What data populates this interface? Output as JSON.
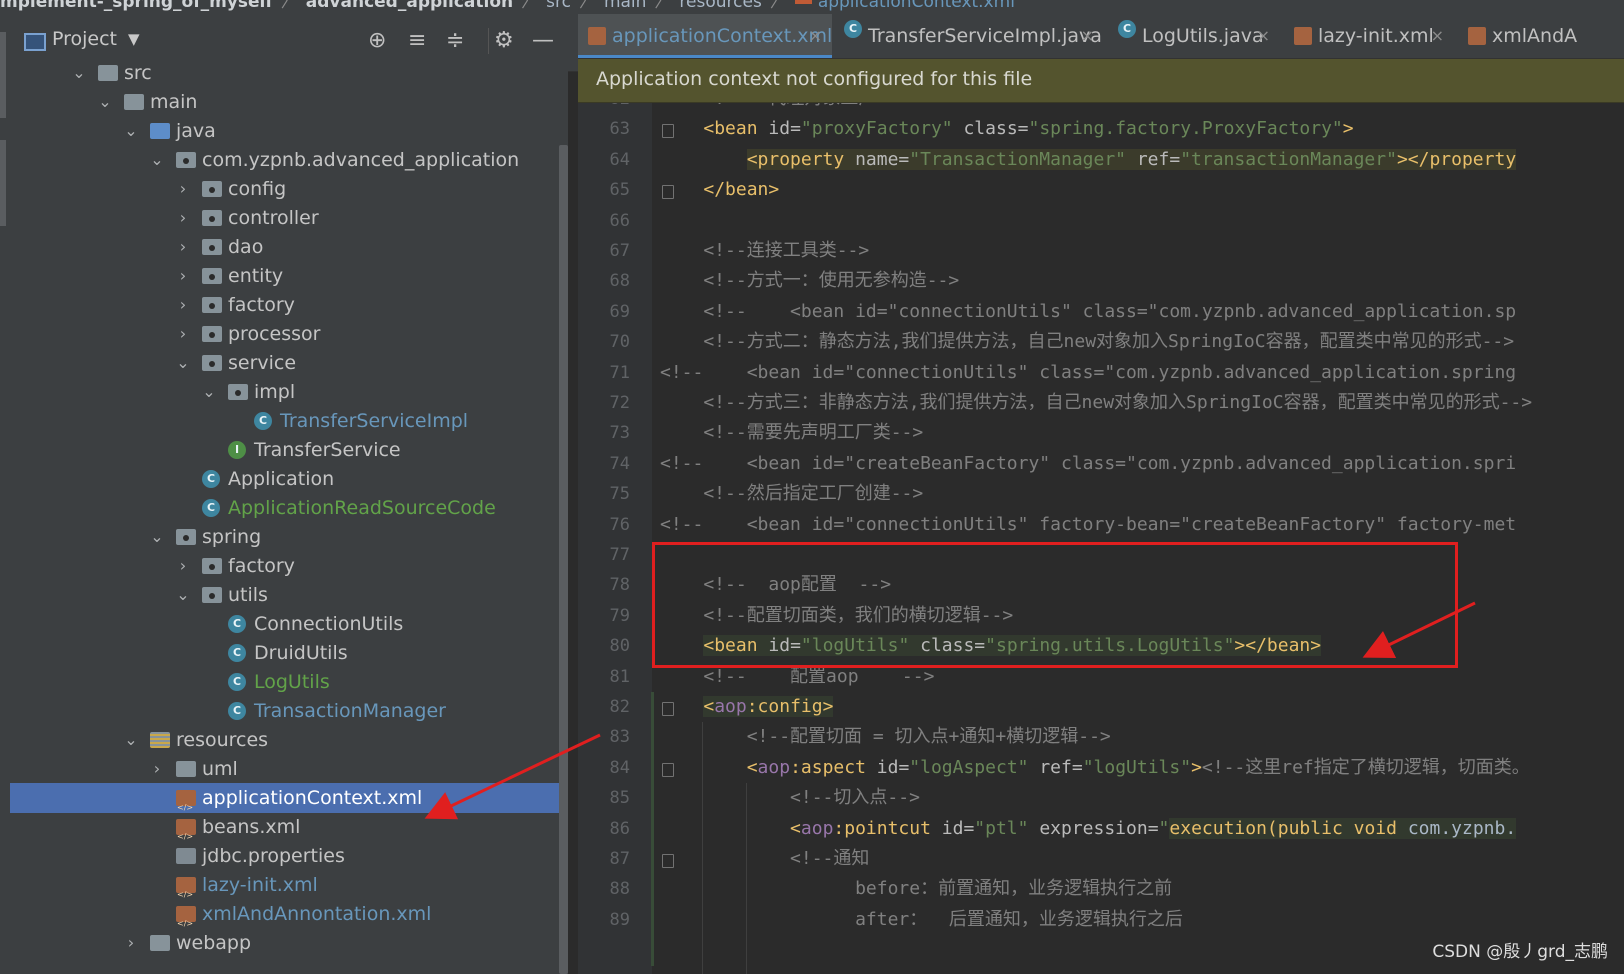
{
  "breadcrumb": {
    "items": [
      "mplement-_spring_of_myself",
      "advanced_application",
      "src",
      "main",
      "resources",
      "applicationContext.xml"
    ],
    "separator": "〉"
  },
  "project_panel": {
    "title": "Project",
    "toolbar_icons": [
      "locate-icon",
      "expand-all-icon",
      "collapse-all-icon",
      "gear-icon",
      "minimize-icon"
    ]
  },
  "tree": [
    {
      "label": "src",
      "depth": 3,
      "type": "folder",
      "open": true
    },
    {
      "label": "main",
      "depth": 4,
      "type": "folder",
      "open": true
    },
    {
      "label": "java",
      "depth": 5,
      "type": "folder-blue",
      "open": true
    },
    {
      "label": "com.yzpnb.advanced_application",
      "depth": 6,
      "type": "package",
      "open": true
    },
    {
      "label": "config",
      "depth": 7,
      "type": "package",
      "open": false
    },
    {
      "label": "controller",
      "depth": 7,
      "type": "package",
      "open": false
    },
    {
      "label": "dao",
      "depth": 7,
      "type": "package",
      "open": false
    },
    {
      "label": "entity",
      "depth": 7,
      "type": "package",
      "open": false
    },
    {
      "label": "factory",
      "depth": 7,
      "type": "package",
      "open": false
    },
    {
      "label": "processor",
      "depth": 7,
      "type": "package",
      "open": false
    },
    {
      "label": "service",
      "depth": 7,
      "type": "package",
      "open": true
    },
    {
      "label": "impl",
      "depth": 8,
      "type": "package",
      "open": true
    },
    {
      "label": "TransferServiceImpl",
      "depth": 9,
      "type": "class",
      "color": "blue"
    },
    {
      "label": "TransferService",
      "depth": 8,
      "type": "interface"
    },
    {
      "label": "Application",
      "depth": 7,
      "type": "class"
    },
    {
      "label": "ApplicationReadSourceCode",
      "depth": 7,
      "type": "class",
      "color": "green"
    },
    {
      "label": "spring",
      "depth": 6,
      "type": "package",
      "open": true
    },
    {
      "label": "factory",
      "depth": 7,
      "type": "package",
      "open": false
    },
    {
      "label": "utils",
      "depth": 7,
      "type": "package",
      "open": true
    },
    {
      "label": "ConnectionUtils",
      "depth": 8,
      "type": "class"
    },
    {
      "label": "DruidUtils",
      "depth": 8,
      "type": "class"
    },
    {
      "label": "LogUtils",
      "depth": 8,
      "type": "class",
      "color": "green"
    },
    {
      "label": "TransactionManager",
      "depth": 8,
      "type": "class",
      "color": "blue"
    },
    {
      "label": "resources",
      "depth": 5,
      "type": "resources",
      "open": true
    },
    {
      "label": "uml",
      "depth": 6,
      "type": "folder",
      "open": false
    },
    {
      "label": "applicationContext.xml",
      "depth": 6,
      "type": "xml",
      "selected": true
    },
    {
      "label": "beans.xml",
      "depth": 6,
      "type": "xml"
    },
    {
      "label": "jdbc.properties",
      "depth": 6,
      "type": "properties"
    },
    {
      "label": "lazy-init.xml",
      "depth": 6,
      "type": "xml",
      "color": "blue"
    },
    {
      "label": "xmlAndAnnontation.xml",
      "depth": 6,
      "type": "xml",
      "color": "blue"
    },
    {
      "label": "webapp",
      "depth": 5,
      "type": "folder",
      "open": false
    }
  ],
  "tabs": [
    {
      "label": "applicationContext.xml",
      "icon": "xml-file-icon",
      "active": true,
      "close": "×"
    },
    {
      "label": "TransferServiceImpl.java",
      "icon": "class-icon",
      "close": "×"
    },
    {
      "label": "LogUtils.java",
      "icon": "class-icon",
      "close": "×"
    },
    {
      "label": "lazy-init.xml",
      "icon": "xml-file-icon",
      "close": "×"
    },
    {
      "label": "xmlAndA",
      "icon": "xml-file-icon"
    }
  ],
  "banner": "Application context not configured for this file",
  "code": [
    {
      "n": "62",
      "parts": [
        [
          "cm",
          "    <!--  代理对象工厂  -->"
        ]
      ]
    },
    {
      "n": "63",
      "parts": [
        [
          "tx",
          "    "
        ],
        [
          "tg",
          "<bean "
        ],
        [
          "at",
          "id="
        ],
        [
          "av",
          "\"proxyFactory\" "
        ],
        [
          "at",
          "class="
        ],
        [
          "av",
          "\"spring.factory.ProxyFactory\""
        ],
        [
          "tg",
          ">"
        ]
      ]
    },
    {
      "n": "64",
      "parts": [
        [
          "tx",
          "        "
        ],
        [
          "tg hl",
          "<property "
        ],
        [
          "at hl",
          "name="
        ],
        [
          "av hl",
          "\"TransactionManager\" "
        ],
        [
          "at hl",
          "ref="
        ],
        [
          "av hl",
          "\"transactionManager\""
        ],
        [
          "tg hl",
          "></property"
        ]
      ]
    },
    {
      "n": "65",
      "parts": [
        [
          "tx",
          "    "
        ],
        [
          "tg",
          "</bean>"
        ]
      ]
    },
    {
      "n": "66",
      "parts": [
        [
          "tx",
          ""
        ]
      ]
    },
    {
      "n": "67",
      "parts": [
        [
          "cm",
          "    <!--连接工具类-->"
        ]
      ]
    },
    {
      "n": "68",
      "parts": [
        [
          "cm",
          "    <!--方式一：使用无参构造-->"
        ]
      ]
    },
    {
      "n": "69",
      "parts": [
        [
          "cm",
          "    <!--    <bean id=\"connectionUtils\" class=\"com.yzpnb.advanced_application.sp"
        ]
      ]
    },
    {
      "n": "70",
      "parts": [
        [
          "cm",
          "    <!--方式二：静态方法,我们提供方法，自己new对象加入SpringIoC容器，配置类中常见的形式-->"
        ]
      ]
    },
    {
      "n": "71",
      "parts": [
        [
          "cm",
          "<!--    <bean id=\"connectionUtils\" class=\"com.yzpnb.advanced_application.spring"
        ]
      ]
    },
    {
      "n": "72",
      "parts": [
        [
          "cm",
          "    <!--方式三：非静态方法,我们提供方法，自己new对象加入SpringIoC容器，配置类中常见的形式-->"
        ]
      ]
    },
    {
      "n": "73",
      "parts": [
        [
          "cm",
          "    <!--需要先声明工厂类-->"
        ]
      ]
    },
    {
      "n": "74",
      "parts": [
        [
          "cm",
          "<!--    <bean id=\"createBeanFactory\" class=\"com.yzpnb.advanced_application.spri"
        ]
      ]
    },
    {
      "n": "75",
      "parts": [
        [
          "cm",
          "    <!--然后指定工厂创建-->"
        ]
      ]
    },
    {
      "n": "76",
      "parts": [
        [
          "cm",
          "<!--    <bean id=\"connectionUtils\" factory-bean=\"createBeanFactory\" factory-met"
        ]
      ]
    },
    {
      "n": "77",
      "parts": [
        [
          "tx",
          ""
        ]
      ]
    },
    {
      "n": "78",
      "parts": [
        [
          "cm",
          "    <!--  aop配置  -->"
        ]
      ]
    },
    {
      "n": "79",
      "parts": [
        [
          "cm",
          "    <!--配置切面类，我们的横切逻辑-->"
        ]
      ]
    },
    {
      "n": "80",
      "parts": [
        [
          "tx",
          "    "
        ],
        [
          "tg hl2",
          "<bean "
        ],
        [
          "at hl2",
          "id="
        ],
        [
          "av hl2",
          "\"logUtils\" "
        ],
        [
          "at hl2",
          "class="
        ],
        [
          "av hl2",
          "\"spring.utils.LogUtils\""
        ],
        [
          "tg hl2",
          "></bean>"
        ]
      ]
    },
    {
      "n": "81",
      "parts": [
        [
          "cm",
          "    <!--    配置aop    -->"
        ]
      ]
    },
    {
      "n": "82",
      "parts": [
        [
          "tx",
          "    "
        ],
        [
          "tg hl2",
          "<"
        ],
        [
          "ns hl2",
          "aop"
        ],
        [
          "tg hl2",
          ":config>"
        ]
      ]
    },
    {
      "n": "83",
      "parts": [
        [
          "cm",
          "        <!--配置切面 = 切入点+通知+横切逻辑-->"
        ]
      ]
    },
    {
      "n": "84",
      "parts": [
        [
          "tx",
          "        "
        ],
        [
          "tg",
          "<"
        ],
        [
          "ns",
          "aop"
        ],
        [
          "tg",
          ":aspect "
        ],
        [
          "at",
          "id="
        ],
        [
          "av",
          "\"logAspect\" "
        ],
        [
          "at",
          "ref="
        ],
        [
          "av",
          "\"logUtils\""
        ],
        [
          "tg",
          ">"
        ],
        [
          "cm",
          "<!--这里ref指定了横切逻辑，切面类。"
        ]
      ]
    },
    {
      "n": "85",
      "parts": [
        [
          "cm",
          "            <!--切入点-->"
        ]
      ]
    },
    {
      "n": "86",
      "parts": [
        [
          "tx",
          "            "
        ],
        [
          "tg",
          "<"
        ],
        [
          "ns",
          "aop"
        ],
        [
          "tg",
          ":pointcut "
        ],
        [
          "at",
          "id="
        ],
        [
          "av",
          "\"ptl\" "
        ],
        [
          "at",
          "expression="
        ],
        [
          "av",
          "\""
        ],
        [
          "tg hl2",
          "execution(public void "
        ],
        [
          "tx hl2",
          "com.yzpnb."
        ]
      ]
    },
    {
      "n": "87",
      "parts": [
        [
          "cm",
          "            <!--通知"
        ]
      ]
    },
    {
      "n": "88",
      "parts": [
        [
          "cm",
          "                  before：前置通知，业务逻辑执行之前"
        ]
      ]
    },
    {
      "n": "89",
      "parts": [
        [
          "cm",
          "                  after：  后置通知，业务逻辑执行之后"
        ]
      ]
    }
  ],
  "watermark": "CSDN @殷丿grd_志鹏",
  "colors": {
    "tag": "#e8bf6a",
    "attr_value": "#6a8759",
    "comment": "#808080",
    "selection": "#4b6eaf",
    "annotation": "#e01f1f"
  }
}
